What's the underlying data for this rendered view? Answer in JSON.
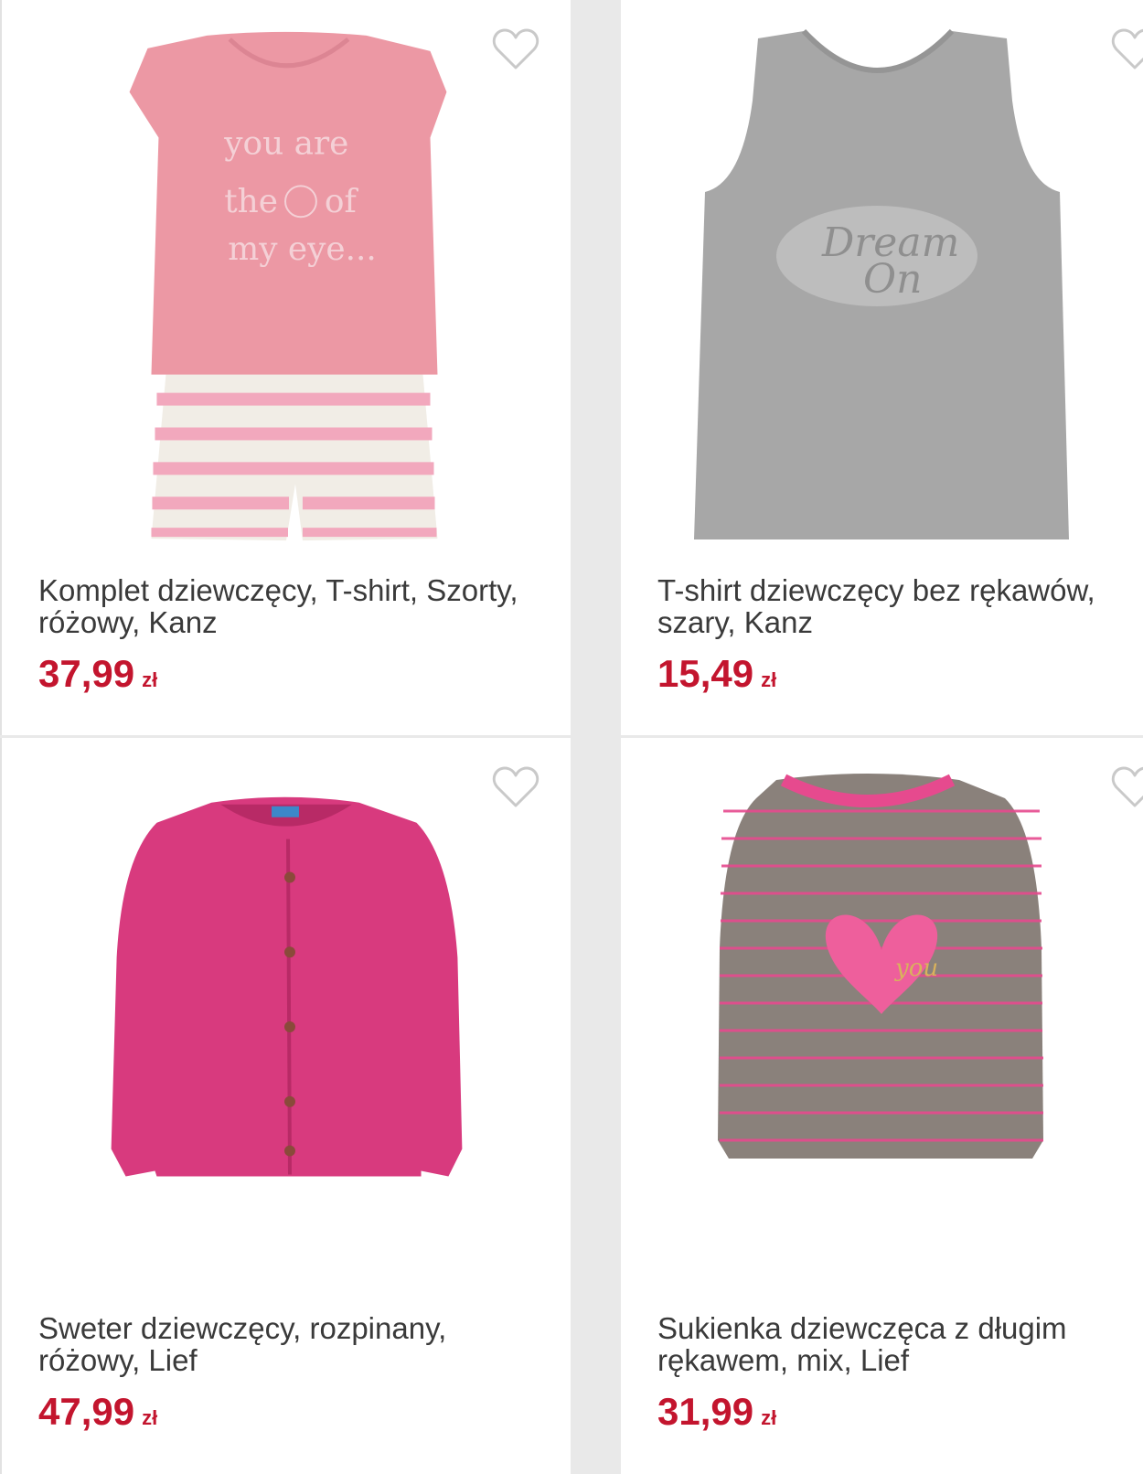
{
  "products": [
    {
      "title": "Komplet dziewczęcy, T-shirt, Szorty, różowy, Kanz",
      "price": "37,99",
      "currency": "zł",
      "print_text": [
        "you are",
        "the",
        "of",
        "my eye..."
      ],
      "icon": "heart-outline-icon"
    },
    {
      "title": "T-shirt dziewczęcy bez rękawów, szary, Kanz",
      "price": "15,49",
      "currency": "zł",
      "print_text": [
        "Dream",
        "On"
      ],
      "icon": "heart-outline-icon"
    },
    {
      "title": "Sweter dziewczęcy, rozpinany, różowy, Lief",
      "price": "47,99",
      "currency": "zł",
      "icon": "heart-outline-icon"
    },
    {
      "title": "Sukienka dziewczęca z długim rękawem, mix, Lief",
      "price": "31,99",
      "currency": "zł",
      "print_text": [
        "you"
      ],
      "icon": "heart-outline-icon"
    }
  ],
  "colors": {
    "price": "#c3152e",
    "title": "#3a3a3a",
    "background": "#e9e9e9",
    "card": "#ffffff"
  }
}
